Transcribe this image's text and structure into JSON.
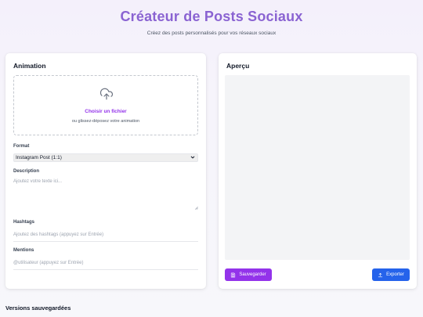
{
  "header": {
    "title": "Créateur de Posts Sociaux",
    "subtitle": "Créez des posts personnalisés pour vos réseaux sociaux"
  },
  "animation_panel": {
    "title": "Animation",
    "upload": {
      "icon": "upload-cloud-icon",
      "choose_label": "Choisir un fichier",
      "hint": "ou glissez-déposez votre animation"
    },
    "format": {
      "label": "Format",
      "selected": "Instagram Post (1:1)"
    },
    "description": {
      "label": "Description",
      "placeholder": "Ajoutez votre texte ici..."
    },
    "hashtags": {
      "label": "Hashtags",
      "placeholder": "Ajoutez des hashtags (appuyez sur Entrée)"
    },
    "mentions": {
      "label": "Mentions",
      "placeholder": "@utilisateur (appuyez sur Entrée)"
    }
  },
  "preview_panel": {
    "title": "Aperçu",
    "save_button": {
      "label": "Sauvegarder",
      "icon": "save-icon"
    },
    "export_button": {
      "label": "Exporter",
      "icon": "download-icon"
    }
  },
  "saved_versions": {
    "title": "Versions sauvegardées"
  },
  "colors": {
    "title": "#8a63d2",
    "accent_purple": "#9333ea",
    "accent_blue": "#2563eb"
  }
}
